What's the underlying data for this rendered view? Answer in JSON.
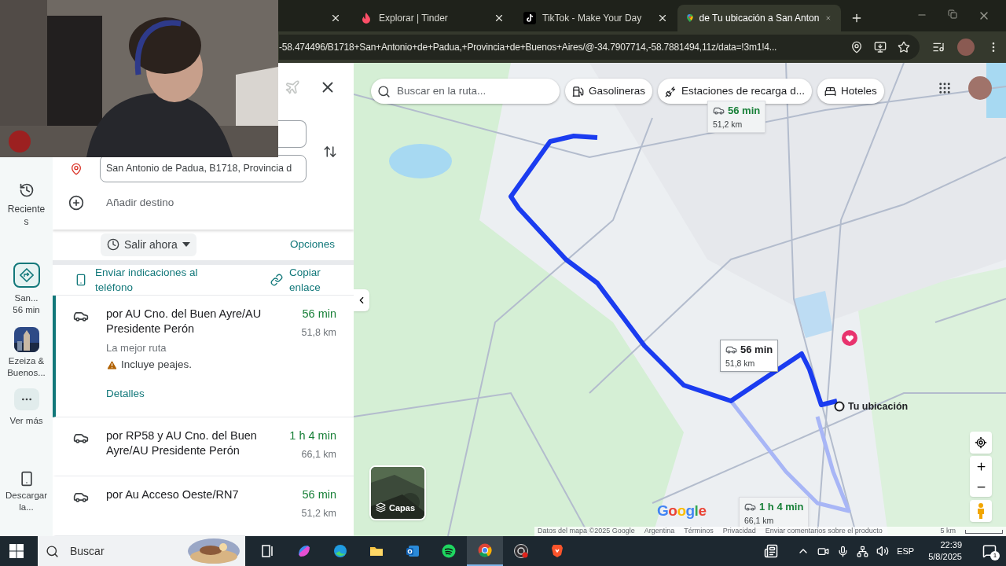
{
  "browser": {
    "tabs": [
      {
        "kind": "partial",
        "selected": false
      },
      {
        "kind": "tinder",
        "title": "Explorar | Tinder",
        "selected": false
      },
      {
        "kind": "tiktok",
        "title": "TikTok - Make Your Day",
        "selected": false
      },
      {
        "kind": "maps",
        "title": "de Tu ubicación a San Anton",
        "selected": true
      }
    ],
    "url": "-58.474496/B1718+San+Antonio+de+Padua,+Provincia+de+Buenos+Aires/@-34.7907714,-58.7881494,11z/data=!3m1!4..."
  },
  "rail": [
    {
      "kind": "recent",
      "label": "Recientes"
    },
    {
      "kind": "route",
      "label": "San...",
      "sub": "56 min",
      "selected": true
    },
    {
      "kind": "place",
      "label": "Ezeiza & Buenos..."
    },
    {
      "kind": "more",
      "label": "Ver más"
    },
    {
      "kind": "download",
      "label": "Descargar la..."
    }
  ],
  "directions": {
    "destination": "San Antonio de Padua, B1718, Provincia d",
    "add_destination": "Añadir destino",
    "depart": "Salir ahora",
    "options": "Opciones",
    "send": "Enviar indicaciones al teléfono",
    "copy": "Copiar enlace"
  },
  "routes": [
    {
      "name": "por AU Cno. del Buen Ayre/AU Presidente Perón",
      "time": "56 min",
      "distance": "51,8 km",
      "note": "La mejor ruta",
      "warning": "Incluye peajes.",
      "details": "Detalles",
      "selected": true
    },
    {
      "name": "por RP58 y AU Cno. del Buen Ayre/AU Presidente Perón",
      "time": "1 h 4 min",
      "distance": "66,1 km",
      "selected": false
    },
    {
      "name": "por Au Acceso Oeste/RN7",
      "time": "56 min",
      "distance": "51,2 km",
      "selected": false
    }
  ],
  "map": {
    "search_placeholder": "Buscar en la ruta...",
    "chips": [
      {
        "kind": "fuel",
        "label": "Gasolineras"
      },
      {
        "kind": "charging",
        "label": "Estaciones de recarga d..."
      },
      {
        "kind": "hotel",
        "label": "Hoteles"
      }
    ],
    "callouts": [
      {
        "time": "56 min",
        "distance": "51,2 km",
        "selected": false
      },
      {
        "time": "56 min",
        "distance": "51,8 km",
        "selected": true
      },
      {
        "time": "1 h 4 min",
        "distance": "66,1 km",
        "selected": false
      }
    ],
    "my_location": "Tu ubicación",
    "layers": "Capas",
    "logo": "Google",
    "footer": [
      "Datos del mapa ©2025 Google",
      "Argentina",
      "Términos",
      "Privacidad",
      "Enviar comentarios sobre el producto"
    ],
    "scale": "5 km"
  },
  "taskbar": {
    "search": "Buscar",
    "apps": [
      {
        "kind": "taskview",
        "selected": false
      },
      {
        "kind": "copilot",
        "selected": false
      },
      {
        "kind": "edge",
        "selected": false
      },
      {
        "kind": "explorer",
        "selected": false
      },
      {
        "kind": "outlook",
        "selected": false
      },
      {
        "kind": "spotify",
        "selected": false
      },
      {
        "kind": "chrome",
        "selected": true
      },
      {
        "kind": "obs",
        "selected": false
      },
      {
        "kind": "brave",
        "selected": false
      }
    ],
    "language": "ESP",
    "time": "22:39",
    "date": "5/8/2025",
    "notifications": "1"
  }
}
